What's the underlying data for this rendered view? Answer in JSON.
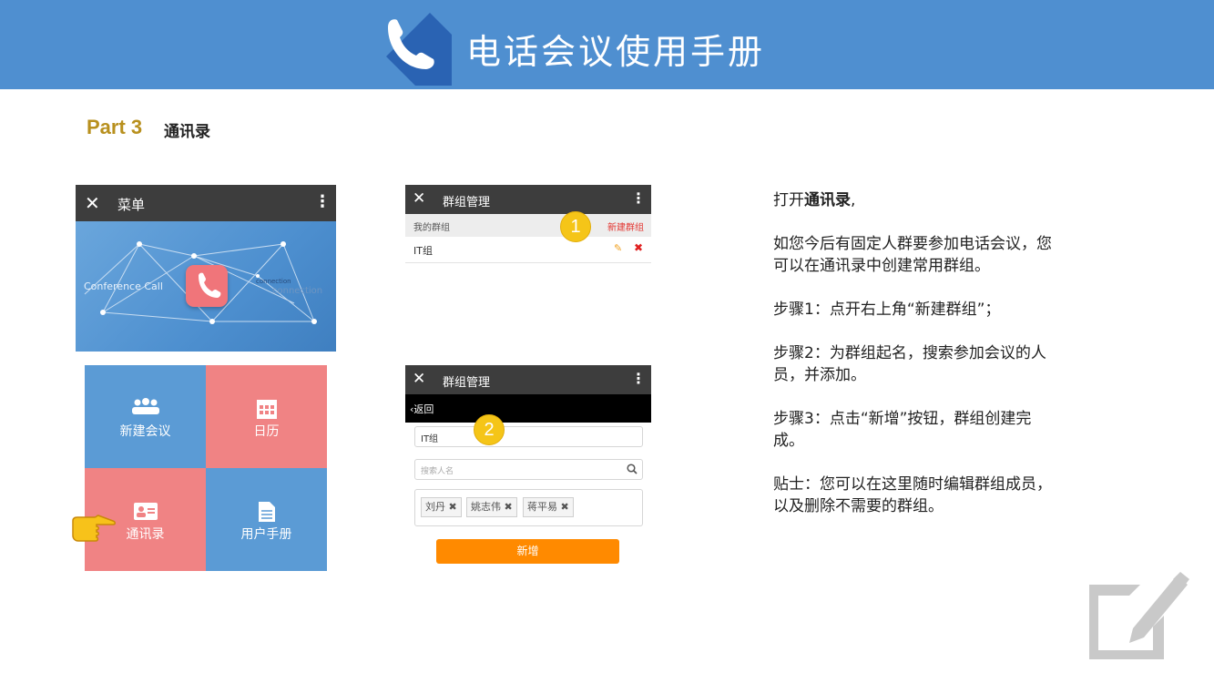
{
  "header": {
    "title": "电话会议使用手册",
    "icon": "phone-handset-icon"
  },
  "section": {
    "part": "Part 3",
    "title": "通讯录"
  },
  "menu_screen": {
    "title": "菜单",
    "hero": {
      "left_text": "Conference Call",
      "right_text_1": "connection",
      "right_text_2": "connection"
    },
    "tiles": [
      {
        "label": "新建会议",
        "icon": "people-group-icon",
        "color": "#5b9bd5"
      },
      {
        "label": "日历",
        "icon": "calendar-icon",
        "color": "#f08384"
      },
      {
        "label": "通讯录",
        "icon": "contact-card-icon",
        "color": "#f08384"
      },
      {
        "label": "用户手册",
        "icon": "document-icon",
        "color": "#5b9bd5"
      }
    ]
  },
  "group_screen_1": {
    "title": "群组管理",
    "my_groups_label": "我的群组",
    "new_group_label": "新建群组",
    "group_name": "IT组",
    "step_number": "1"
  },
  "group_screen_2": {
    "title": "群组管理",
    "back_label": "返回",
    "name_value": "IT组",
    "search_placeholder": "搜索人名",
    "members": [
      "刘丹",
      "姚志伟",
      "蒋平易"
    ],
    "add_button": "新增",
    "step_number": "2"
  },
  "instructions": {
    "line1_prefix": "打开",
    "line1_bold": "通讯录",
    "line1_suffix": ",",
    "para1": "如您今后有固定人群要参加电话会议，您可以在通讯录中创建常用群组。",
    "step1": "步骤1：点开右上角“新建群组”；",
    "step2": "步骤2：为群组起名，搜索参加会议的人员，并添加。",
    "step3": "步骤3：点击“新增”按钮，群组创建完成。",
    "tip": "贴士：您可以在这里随时编辑群组成员，以及删除不需要的群组。"
  },
  "colors": {
    "banner": "#4f8fd0",
    "accent_gold": "#b8901e",
    "tile_blue": "#5b9bd5",
    "tile_red": "#f08384",
    "button_orange": "#ff8a00",
    "badge_yellow": "#f5c518"
  }
}
